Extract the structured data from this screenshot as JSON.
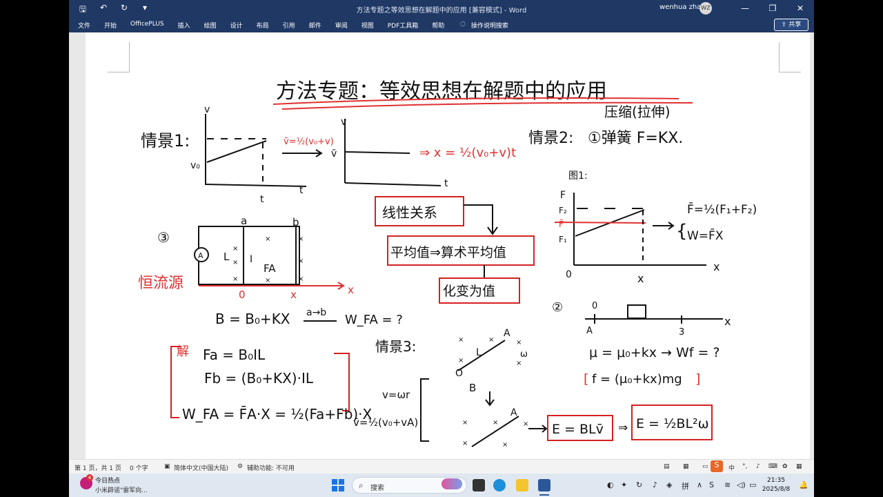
{
  "window": {
    "title": "方法专题之等效思想在解题中的应用 [兼容模式] - Word",
    "user_name": "wenhua zha",
    "avatar_initials": "WZ"
  },
  "ribbon": {
    "tabs": [
      "文件",
      "开始",
      "OfficePLUS",
      "插入",
      "绘图",
      "设计",
      "布局",
      "引用",
      "邮件",
      "审阅",
      "视图",
      "PDF工具箱",
      "帮助"
    ],
    "tell_me": "操作说明搜索",
    "share": "共享"
  },
  "handwriting": {
    "title": "方法专题：等效思想在解题中的应用",
    "scene1": "情景1:",
    "scene2": "情景2:",
    "scene3": "情景3:",
    "v_label": "v",
    "v0_label": "v₀",
    "t_label": "t",
    "vbar_formula": "v̄=½(v₀+v)",
    "vbar_label": "v̄",
    "x_formula": "⇒ x = ½(v₀+v)t",
    "spring_label": "压缩(拉伸)",
    "spring_formula": "①弹簧 F=KX.",
    "example_label": "图1:",
    "force_F": "F",
    "force_F2": "F₂",
    "force_Fbar": "F̄",
    "force_F1": "F₁",
    "origin": "0",
    "x_axis": "x",
    "fbar_formula": "F̄=½(F₁+F₂)",
    "work_formula": "W=F̄X",
    "linear": "线性关系",
    "average": "平均值⇒算术平均值",
    "variable": "化变为值",
    "circle3": "③",
    "circle2": "②",
    "rail_a": "a",
    "rail_b": "b",
    "rod_L": "L",
    "current_I": "I",
    "force_FA": "FA",
    "source": "恒流源",
    "pos0": "0",
    "posx": "x",
    "field_formula": "B = B₀+KX",
    "a_to_b": "a→b",
    "work_question": "W_FA = ?",
    "solution_label": "解",
    "fa_formula": "Fa = B₀IL",
    "fb_formula": "Fb = (B₀+KX)·IL",
    "wfa_formula": "W_FA = F̄A·X = ½(Fa+Fb)·X",
    "label_A": "A",
    "label_B": "B",
    "label_O": "O",
    "omega": "ω",
    "v_omega": "v=ωr",
    "vbar_rot": "v̄=½(v₀+vA)",
    "emf1": "E = BLv̄",
    "emf2": "E = ½BL²ω",
    "num_0": "0",
    "num_3": "3",
    "mu_formula": "μ = μ₀+kx → Wf = ?",
    "friction": "f = (μ₀+kx)mg"
  },
  "status": {
    "page": "第 1 页，共 1 页",
    "words": "0 个字",
    "language": "简体中文(中国大陆)",
    "accessibility": "辅助功能: 不可用"
  },
  "taskbar": {
    "news_badge": "4",
    "news_title": "今日热点",
    "news_sub": "小米辟谣\"雷军向...",
    "search": "搜索",
    "ime": "中",
    "time": "21:35",
    "date": "2025/8/8"
  },
  "colors": {
    "titlebar": "#1f3864",
    "ink": "#111111",
    "red_ink": "#e03030",
    "red_box": "#d42020"
  }
}
